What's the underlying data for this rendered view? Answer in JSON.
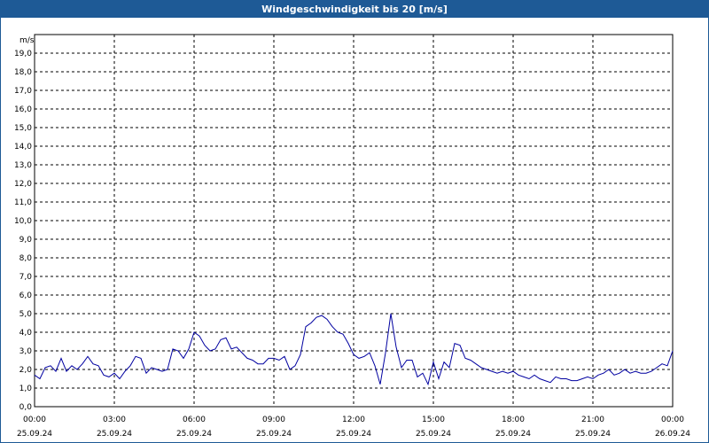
{
  "chart_data": {
    "type": "line",
    "title": "Windgeschwindigkeit bis 20 [m/s]",
    "ylabel": "m/s",
    "xlabel": "",
    "ylim": [
      0,
      20
    ],
    "xlim": [
      0,
      24
    ],
    "grid": true,
    "line_color": "#0000a0",
    "y_ticks": [
      "0,0",
      "1,0",
      "2,0",
      "3,0",
      "4,0",
      "5,0",
      "6,0",
      "7,0",
      "8,0",
      "9,0",
      "10,0",
      "11,0",
      "12,0",
      "13,0",
      "14,0",
      "15,0",
      "16,0",
      "17,0",
      "18,0",
      "19,0"
    ],
    "x_ticks": [
      {
        "time": "00:00",
        "date": "25.09.24"
      },
      {
        "time": "03:00",
        "date": "25.09.24"
      },
      {
        "time": "06:00",
        "date": "25.09.24"
      },
      {
        "time": "09:00",
        "date": "25.09.24"
      },
      {
        "time": "12:00",
        "date": "25.09.24"
      },
      {
        "time": "15:00",
        "date": "25.09.24"
      },
      {
        "time": "18:00",
        "date": "25.09.24"
      },
      {
        "time": "21:00",
        "date": "25.09.24"
      },
      {
        "time": "00:00",
        "date": "26.09.24"
      }
    ],
    "series": [
      {
        "x": [
          0,
          0.2,
          0.4,
          0.6,
          0.8,
          1.0,
          1.2,
          1.4,
          1.6,
          1.8,
          2.0,
          2.2,
          2.4,
          2.6,
          2.8,
          3.0,
          3.2,
          3.4,
          3.6,
          3.8,
          4.0,
          4.2,
          4.4,
          4.6,
          4.8,
          5.0,
          5.2,
          5.4,
          5.6,
          5.8,
          6.0,
          6.2,
          6.4,
          6.6,
          6.8,
          7.0,
          7.2,
          7.4,
          7.6,
          7.8,
          8.0,
          8.2,
          8.4,
          8.6,
          8.8,
          9.0,
          9.2,
          9.4,
          9.6,
          9.8,
          10.0,
          10.2,
          10.4,
          10.6,
          10.8,
          11.0,
          11.2,
          11.4,
          11.6,
          11.8,
          12.0,
          12.2,
          12.4,
          12.6,
          12.8,
          13.0,
          13.2,
          13.4,
          13.6,
          13.8,
          14.0,
          14.2,
          14.4,
          14.6,
          14.8,
          15.0,
          15.2,
          15.4,
          15.6,
          15.8,
          16.0,
          16.2,
          16.4,
          16.6,
          16.8,
          17.0,
          17.2,
          17.4,
          17.6,
          17.8,
          18.0,
          18.2,
          18.4,
          18.6,
          18.8,
          19.0,
          19.2,
          19.4,
          19.6,
          19.8,
          20.0,
          20.2,
          20.4,
          20.6,
          20.8,
          21.0,
          21.2,
          21.4,
          21.6,
          21.8,
          22.0,
          22.2,
          22.4,
          22.6,
          22.8,
          23.0,
          23.2,
          23.4,
          23.6,
          23.8,
          24.0
        ],
        "values": [
          1.7,
          1.5,
          2.1,
          2.2,
          1.9,
          2.6,
          1.9,
          2.2,
          2.0,
          2.3,
          2.7,
          2.3,
          2.2,
          1.7,
          1.6,
          1.8,
          1.5,
          1.9,
          2.2,
          2.7,
          2.6,
          1.8,
          2.1,
          2.0,
          1.9,
          2.0,
          3.1,
          3.0,
          2.6,
          3.1,
          4.0,
          3.8,
          3.3,
          3.0,
          3.1,
          3.6,
          3.7,
          3.1,
          3.2,
          2.9,
          2.6,
          2.5,
          2.3,
          2.3,
          2.6,
          2.6,
          2.5,
          2.7,
          2.0,
          2.2,
          2.8,
          4.3,
          4.5,
          4.8,
          4.9,
          4.7,
          4.3,
          4.0,
          3.9,
          3.4,
          2.8,
          2.6,
          2.7,
          2.9,
          2.2,
          1.2,
          2.9,
          5.0,
          3.2,
          2.1,
          2.5,
          2.5,
          1.6,
          1.8,
          1.2,
          2.4,
          1.5,
          2.4,
          2.1,
          3.4,
          3.3,
          2.6,
          2.5,
          2.3,
          2.1,
          2.0,
          1.9,
          1.8,
          1.9,
          1.8,
          1.9,
          1.7,
          1.6,
          1.5,
          1.7,
          1.5,
          1.4,
          1.3,
          1.6,
          1.5,
          1.5,
          1.4,
          1.4,
          1.5,
          1.6,
          1.5,
          1.7,
          1.8,
          2.0,
          1.7,
          1.8,
          2.0,
          1.8,
          1.9,
          1.8,
          1.8,
          1.9,
          2.1,
          2.3,
          2.2,
          3.0
        ]
      }
    ]
  }
}
